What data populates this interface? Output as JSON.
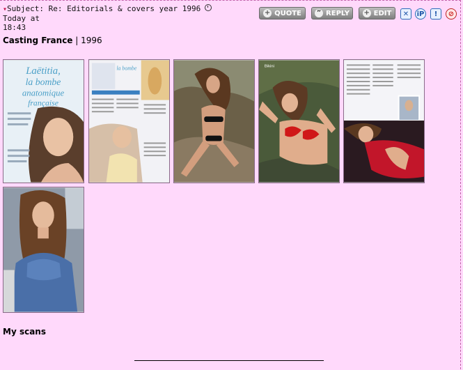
{
  "post": {
    "subject_prefix": "Subject:",
    "subject": "Re: Editorials & covers year 1996",
    "date_line1": "Today at",
    "time": "18:43"
  },
  "actions": {
    "quote": "QUOTE",
    "reply": "REPLY",
    "edit": "EDIT",
    "delete_icon": "close-icon",
    "ip_label": "iP",
    "report_label": "!",
    "warn_icon": "no-entry-icon"
  },
  "content": {
    "magazine": "Casting France",
    "separator": " | ",
    "year": "1996",
    "thumbnails": [
      {
        "name": "scan-1-cover-page"
      },
      {
        "name": "scan-2-article-page"
      },
      {
        "name": "scan-3-bikini-rocks"
      },
      {
        "name": "scan-4-red-bikini"
      },
      {
        "name": "scan-5-red-dress"
      },
      {
        "name": "scan-6-blue-top"
      }
    ],
    "cover_text_1": "Laëtitia,",
    "cover_text_2": "la bombe",
    "cover_text_3": "anatomique",
    "cover_text_4": "française",
    "footer_note": "My scans"
  },
  "colors": {
    "background": "#ffd9fb",
    "button_gray": "#8f8f8f",
    "icon_blue": "#2a6cb8"
  }
}
